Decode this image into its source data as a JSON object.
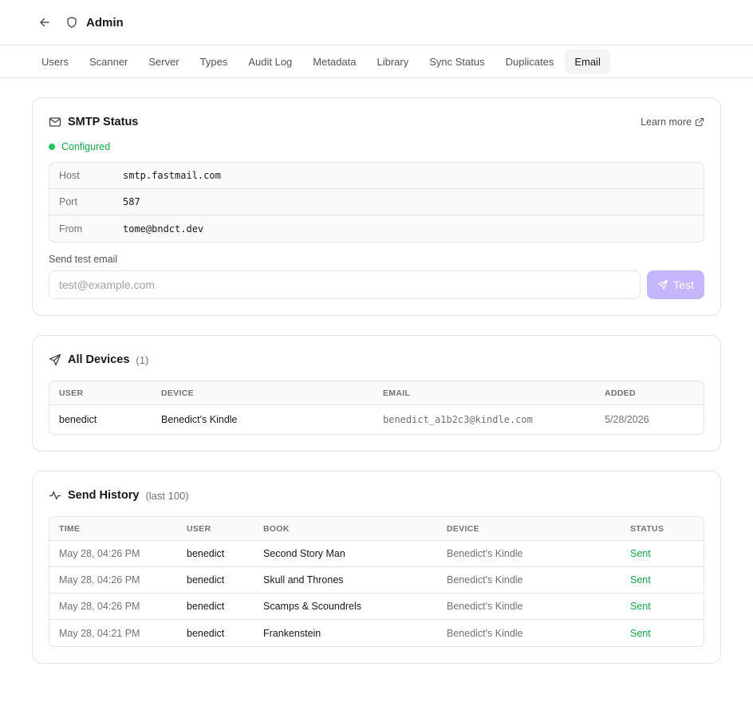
{
  "header": {
    "title": "Admin",
    "back_icon": "arrow-left-icon",
    "app_icon": "shield-icon"
  },
  "tabs": [
    {
      "label": "Users",
      "active": false
    },
    {
      "label": "Scanner",
      "active": false
    },
    {
      "label": "Server",
      "active": false
    },
    {
      "label": "Types",
      "active": false
    },
    {
      "label": "Audit Log",
      "active": false
    },
    {
      "label": "Metadata",
      "active": false
    },
    {
      "label": "Library",
      "active": false
    },
    {
      "label": "Sync Status",
      "active": false
    },
    {
      "label": "Duplicates",
      "active": false
    },
    {
      "label": "Email",
      "active": true
    }
  ],
  "smtp": {
    "title": "SMTP Status",
    "learn_more": "Learn more",
    "status": "Configured",
    "status_color": "#22c55e",
    "rows": [
      {
        "key": "Host",
        "value": "smtp.fastmail.com"
      },
      {
        "key": "Port",
        "value": "587"
      },
      {
        "key": "From",
        "value": "tome@bndct.dev"
      }
    ],
    "test_label": "Send test email",
    "test_placeholder": "test@example.com",
    "test_button": "Test",
    "accent": "#c4b5fd"
  },
  "devices": {
    "title": "All Devices",
    "count": "(1)",
    "columns": [
      "User",
      "Device",
      "Email",
      "Added"
    ],
    "rows": [
      {
        "user": "benedict",
        "device": "Benedict's Kindle",
        "email": "benedict_a1b2c3@kindle.com",
        "added": "5/28/2026"
      }
    ]
  },
  "history": {
    "title": "Send History",
    "subtitle": "(last 100)",
    "columns": [
      "Time",
      "User",
      "Book",
      "Device",
      "Status"
    ],
    "rows": [
      {
        "time": "May 28, 04:26 PM",
        "user": "benedict",
        "book": "Second Story Man",
        "device": "Benedict's Kindle",
        "status": "Sent"
      },
      {
        "time": "May 28, 04:26 PM",
        "user": "benedict",
        "book": "Skull and Thrones",
        "device": "Benedict's Kindle",
        "status": "Sent"
      },
      {
        "time": "May 28, 04:26 PM",
        "user": "benedict",
        "book": "Scamps & Scoundrels",
        "device": "Benedict's Kindle",
        "status": "Sent"
      },
      {
        "time": "May 28, 04:21 PM",
        "user": "benedict",
        "book": "Frankenstein",
        "device": "Benedict's Kindle",
        "status": "Sent"
      }
    ]
  }
}
